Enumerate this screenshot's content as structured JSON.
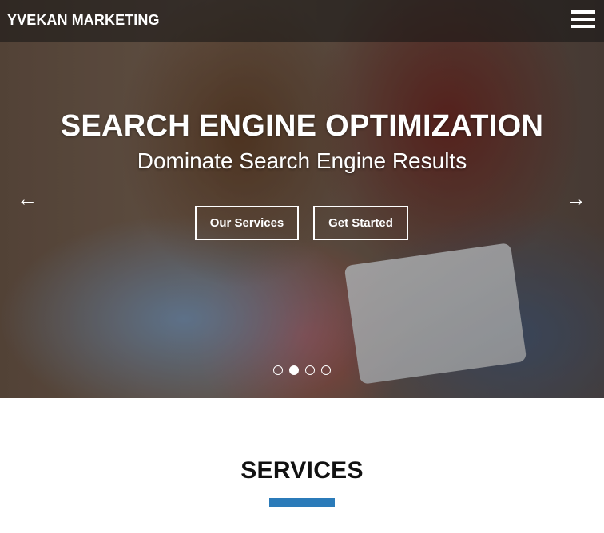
{
  "header": {
    "brand": "YVEKAN MARKETING",
    "menu_icon": "hamburger-menu-icon"
  },
  "hero": {
    "headline": "SEARCH ENGINE OPTIMIZATION",
    "subheadline": "Dominate Search Engine Results",
    "prev_arrow": "←",
    "next_arrow": "→",
    "buttons": [
      {
        "label": "Our Services"
      },
      {
        "label": "Get Started"
      }
    ],
    "indicators": {
      "count": 4,
      "active_index": 1
    },
    "image": "two women looking at a tablet"
  },
  "services": {
    "title": "SERVICES",
    "accent_color": "#2b7bb9"
  }
}
